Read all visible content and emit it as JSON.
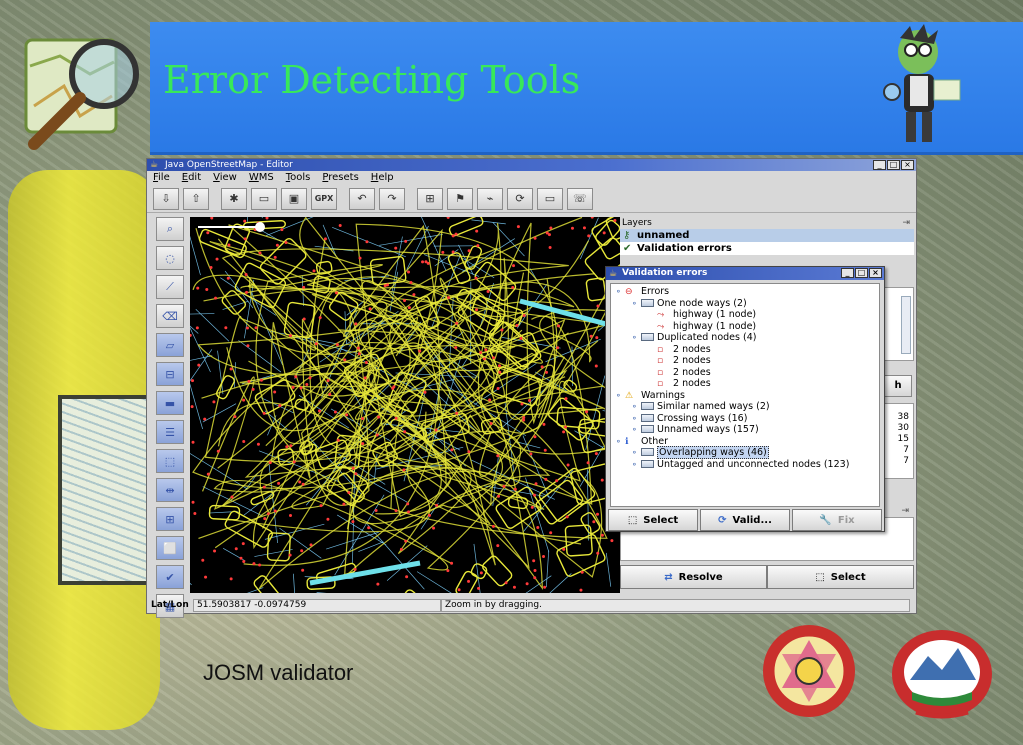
{
  "slide": {
    "title": "Error Detecting Tools",
    "caption": "JOSM validator"
  },
  "window": {
    "title": "Java OpenStreetMap - Editor",
    "controls": [
      "_",
      "□",
      "×"
    ],
    "menu": [
      "File",
      "Edit",
      "View",
      "WMS",
      "Tools",
      "Presets",
      "Help"
    ],
    "toolbar_gpx": "GPX"
  },
  "layers": {
    "header": "Layers",
    "items": [
      {
        "label": "unnamed",
        "selected": true
      },
      {
        "label": "Validation errors",
        "selected": false
      }
    ]
  },
  "panel_numbers": [
    "38",
    "30",
    "15",
    "7",
    "7"
  ],
  "panel_partial_button": "h",
  "bottom_buttons": {
    "resolve": "Resolve",
    "select": "Select"
  },
  "status": {
    "label": "Lat/Lon",
    "coords": "51.5903817 -0.0974759",
    "help": "Zoom in by dragging."
  },
  "validation": {
    "title": "Validation errors",
    "tree": [
      {
        "level": 0,
        "icon": "error-icon",
        "label": "Errors"
      },
      {
        "level": 1,
        "icon": "folder-icon",
        "label": "One node ways (2)"
      },
      {
        "level": 2,
        "icon": "way-icon",
        "label": "highway (1 node)"
      },
      {
        "level": 2,
        "icon": "way-icon",
        "label": "highway (1 node)"
      },
      {
        "level": 1,
        "icon": "folder-icon",
        "label": "Duplicated nodes (4)"
      },
      {
        "level": 2,
        "icon": "node-icon",
        "label": "2 nodes"
      },
      {
        "level": 2,
        "icon": "node-icon",
        "label": "2 nodes"
      },
      {
        "level": 2,
        "icon": "node-icon",
        "label": "2 nodes"
      },
      {
        "level": 2,
        "icon": "node-icon",
        "label": "2 nodes"
      },
      {
        "level": 0,
        "icon": "warning-icon",
        "label": "Warnings"
      },
      {
        "level": 1,
        "icon": "folder-icon",
        "label": "Similar named ways (2)"
      },
      {
        "level": 1,
        "icon": "folder-icon",
        "label": "Crossing ways (16)"
      },
      {
        "level": 1,
        "icon": "folder-icon",
        "label": "Unnamed ways (157)"
      },
      {
        "level": 0,
        "icon": "info-icon",
        "label": "Other"
      },
      {
        "level": 1,
        "icon": "folder-icon",
        "label": "Overlapping ways (46)",
        "highlight": true
      },
      {
        "level": 1,
        "icon": "folder-icon",
        "label": "Untagged and unconnected nodes (123)"
      }
    ],
    "buttons": {
      "select": "Select",
      "validate": "Valid...",
      "fix": "Fix"
    }
  },
  "colors": {
    "banner": "#2a79e6",
    "title_text": "#38e85a",
    "map_background": "#000000",
    "ways": "#e8e83a",
    "segments": "#7fd3ff",
    "selected_way": "#6ee0ea",
    "nodes": "#ff3a3a"
  }
}
